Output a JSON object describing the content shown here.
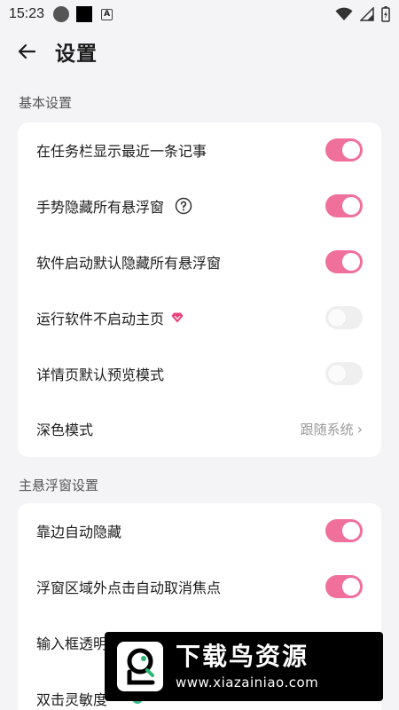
{
  "status_bar": {
    "time": "15:23",
    "indicator_a": "A"
  },
  "header": {
    "title": "设置"
  },
  "sections": [
    {
      "title": "基本设置",
      "rows": [
        {
          "label": "在任务栏显示最近一条记事",
          "toggle": "on"
        },
        {
          "label": "手势隐藏所有悬浮窗",
          "toggle": "on",
          "help": true
        },
        {
          "label": "软件启动默认隐藏所有悬浮窗",
          "toggle": "on"
        },
        {
          "label": "运行软件不启动主页",
          "toggle": "off",
          "vip": true
        },
        {
          "label": "详情页默认预览模式",
          "toggle": "off"
        },
        {
          "label": "深色模式",
          "value": "跟随系统"
        }
      ]
    },
    {
      "title": "主悬浮窗设置",
      "rows": [
        {
          "label": "靠边自动隐藏",
          "toggle": "on"
        },
        {
          "label": "浮窗区域外点击自动取消焦点",
          "toggle": "on"
        },
        {
          "label": "输入框透明"
        },
        {
          "label": "双击灵敏度"
        }
      ]
    }
  ],
  "watermark": {
    "title": "下载鸟资源",
    "url": "www.xiazainiao.com"
  },
  "colors": {
    "accent": "#f0709c",
    "background": "#f4f4f6",
    "green": "#3cba8e"
  }
}
